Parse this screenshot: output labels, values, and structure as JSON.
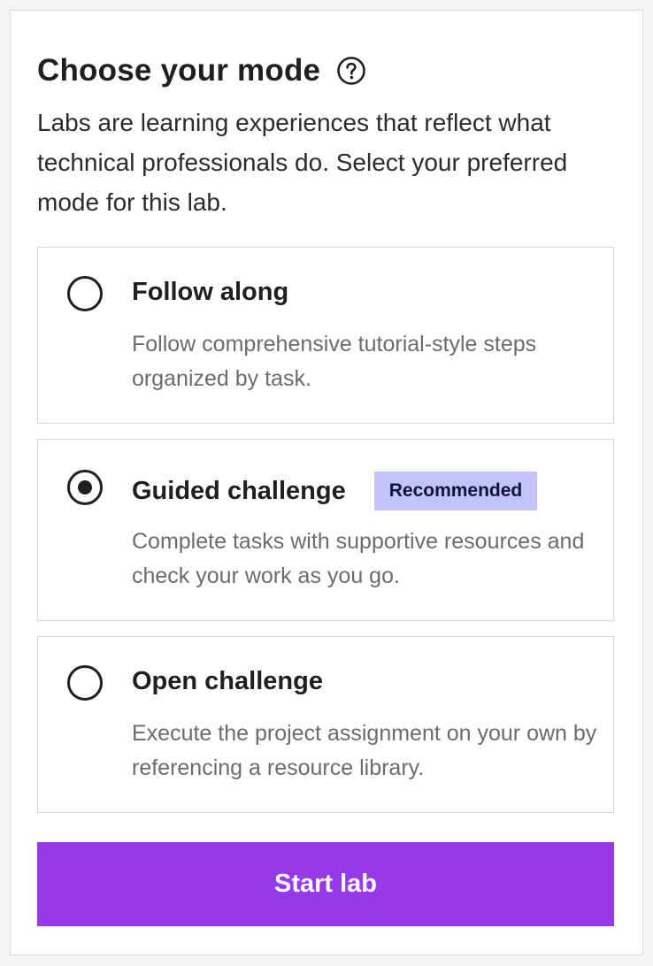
{
  "header": {
    "title": "Choose your mode",
    "help_icon": "question-circle-icon"
  },
  "intro": "Labs are learning experiences that reflect what technical professionals do. Select your preferred mode for this lab.",
  "options": [
    {
      "title": "Follow along",
      "description": "Follow comprehensive tutorial-style steps organized by task.",
      "selected": false,
      "badge": ""
    },
    {
      "title": "Guided challenge",
      "description": "Complete tasks with supportive resources and check your work as you go.",
      "selected": true,
      "badge": "Recommended"
    },
    {
      "title": "Open challenge",
      "description": "Execute the project assignment on your own by referencing a resource library.",
      "selected": false,
      "badge": ""
    }
  ],
  "start_button": {
    "label": "Start lab"
  },
  "colors": {
    "primary": "#9639e6",
    "badge_bg": "#c3c2fb",
    "badge_text": "#11113a",
    "muted_text": "#6b6b70"
  }
}
